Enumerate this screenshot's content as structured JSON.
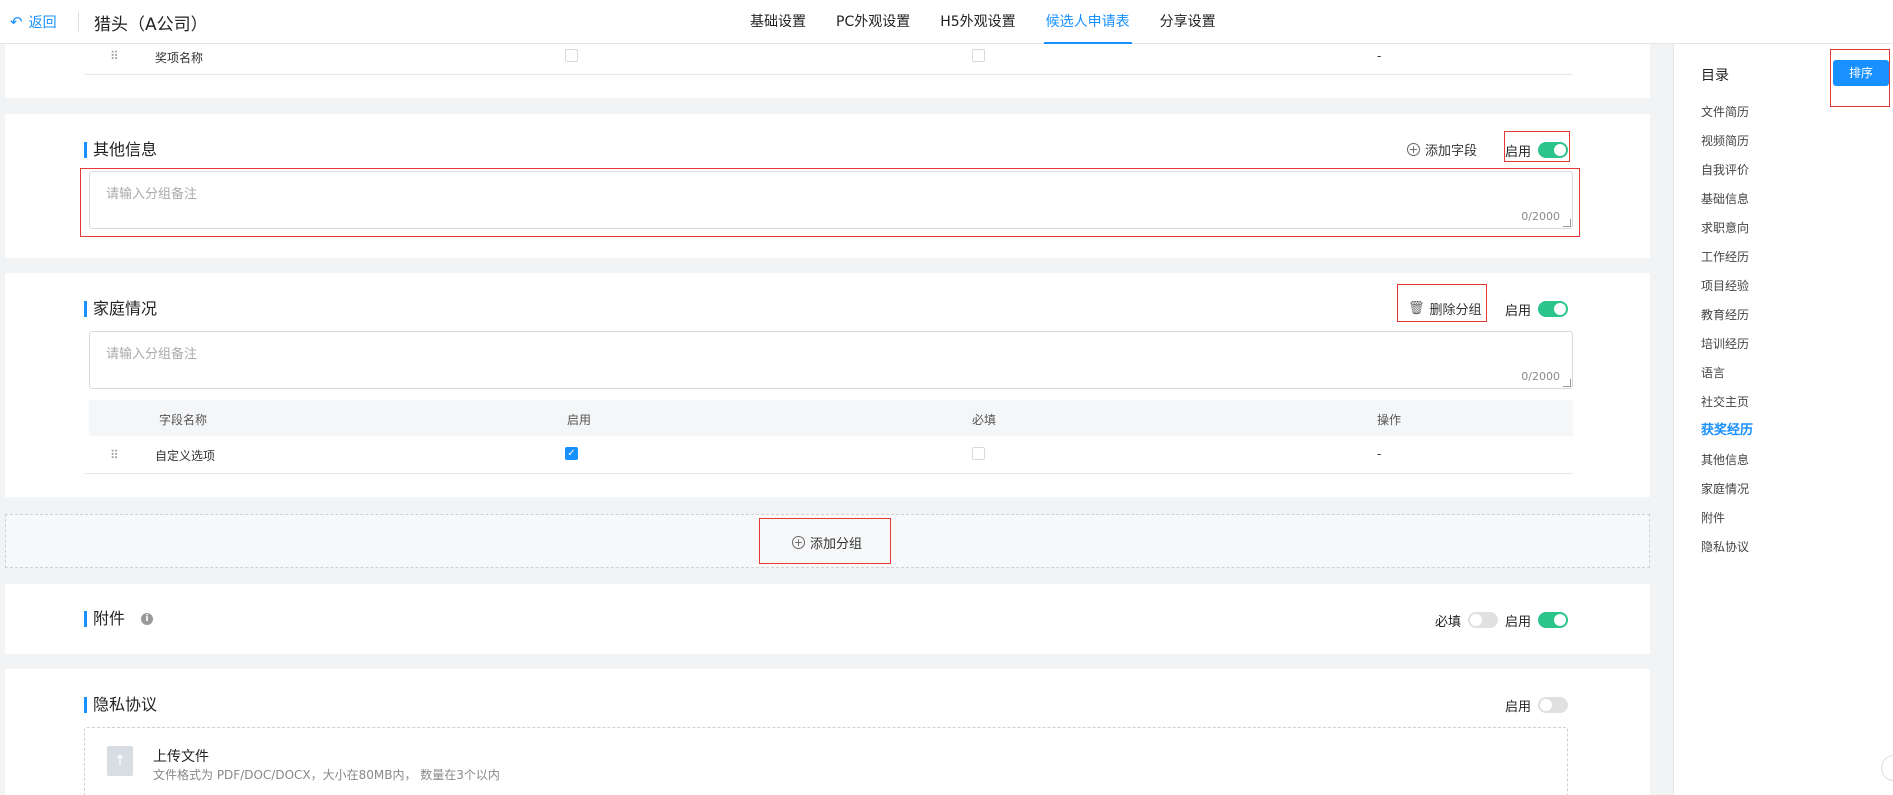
{
  "header": {
    "back_label": "返回",
    "title": "猎头（A公司）",
    "tabs": [
      {
        "label": "基础设置",
        "active": false
      },
      {
        "label": "PC外观设置",
        "active": false
      },
      {
        "label": "H5外观设置",
        "active": false
      },
      {
        "label": "候选人申请表",
        "active": true
      },
      {
        "label": "分享设置",
        "active": false
      }
    ]
  },
  "awards_row": {
    "field_name": "奖项名称",
    "enabled": false,
    "required": false,
    "action": "-"
  },
  "other_info": {
    "title": "其他信息",
    "add_field_label": "添加字段",
    "enable_label": "启用",
    "enabled": true,
    "note_placeholder": "请输入分组备注",
    "note_count": "0/2000"
  },
  "family": {
    "title": "家庭情况",
    "delete_group_label": "删除分组",
    "enable_label": "启用",
    "enabled": true,
    "note_placeholder": "请输入分组备注",
    "note_count": "0/2000",
    "columns": [
      "字段名称",
      "启用",
      "必填",
      "操作"
    ],
    "rows": [
      {
        "field_name": "自定义选项",
        "enabled": true,
        "required": false,
        "action": "-"
      }
    ]
  },
  "add_group_label": "添加分组",
  "attachments": {
    "title": "附件",
    "required_label": "必填",
    "required": false,
    "enable_label": "启用",
    "enabled": true
  },
  "privacy": {
    "title": "隐私协议",
    "enable_label": "启用",
    "enabled": false,
    "upload_title": "上传文件",
    "upload_hint": "文件格式为 PDF/DOC/DOCX，大小在80MB内， 数量在3个以内"
  },
  "sidebar": {
    "title": "目录",
    "sort_label": "排序",
    "items": [
      {
        "label": "文件简历",
        "active": false
      },
      {
        "label": "视频简历",
        "active": false
      },
      {
        "label": "自我评价",
        "active": false
      },
      {
        "label": "基础信息",
        "active": false
      },
      {
        "label": "求职意向",
        "active": false
      },
      {
        "label": "工作经历",
        "active": false
      },
      {
        "label": "项目经验",
        "active": false
      },
      {
        "label": "教育经历",
        "active": false
      },
      {
        "label": "培训经历",
        "active": false
      },
      {
        "label": "语言",
        "active": false
      },
      {
        "label": "社交主页",
        "active": false
      },
      {
        "label": "获奖经历",
        "active": true
      },
      {
        "label": "其他信息",
        "active": false
      },
      {
        "label": "家庭情况",
        "active": false
      },
      {
        "label": "附件",
        "active": false
      },
      {
        "label": "隐私协议",
        "active": false
      }
    ]
  },
  "colors": {
    "accent": "#1890ff",
    "toggle_on": "#2bc48a",
    "highlight_box": "#e53935"
  }
}
